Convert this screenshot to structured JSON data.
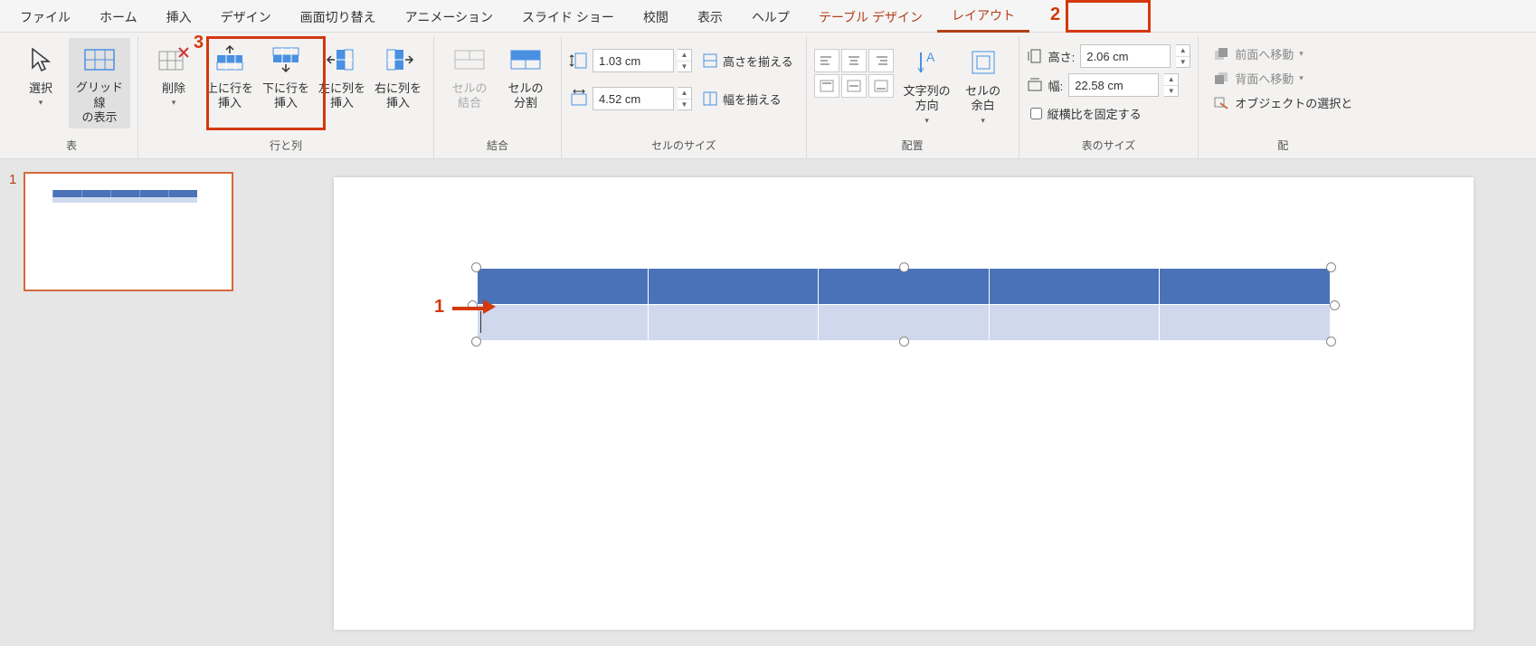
{
  "menu": {
    "file": "ファイル",
    "home": "ホーム",
    "insert": "挿入",
    "design": "デザイン",
    "transitions": "画面切り替え",
    "animations": "アニメーション",
    "slideshow": "スライド ショー",
    "review": "校閲",
    "view": "表示",
    "help": "ヘルプ",
    "table_design": "テーブル デザイン",
    "layout": "レイアウト"
  },
  "ribbon": {
    "table_group": "表",
    "select": "選択",
    "gridlines": "グリッド線\nの表示",
    "delete": "削除",
    "rows_cols_group": "行と列",
    "insert_row_above": "上に行を\n挿入",
    "insert_row_below": "下に行を\n挿入",
    "insert_col_left": "左に列を\n挿入",
    "insert_col_right": "右に列を\n挿入",
    "merge_group": "結合",
    "merge_cells": "セルの\n結合",
    "split_cells": "セルの\n分割",
    "cell_size_group": "セルのサイズ",
    "row_height": "1.03 cm",
    "col_width": "4.52 cm",
    "distribute_rows": "高さを揃える",
    "distribute_cols": "幅を揃える",
    "alignment_group": "配置",
    "text_direction": "文字列の\n方向",
    "cell_margin": "セルの\n余白",
    "table_size_group": "表のサイズ",
    "height_label": "高さ:",
    "width_label": "幅:",
    "table_height": "2.06 cm",
    "table_width": "22.58 cm",
    "lock_aspect": "縦横比を固定する",
    "arrange_group": "配",
    "bring_forward": "前面へ移動",
    "send_backward": "背面へ移動",
    "selection_pane": "オブジェクトの選択と"
  },
  "thumbnail": {
    "num": "1"
  },
  "callouts": {
    "c1": "1",
    "c2": "2",
    "c3": "3"
  }
}
